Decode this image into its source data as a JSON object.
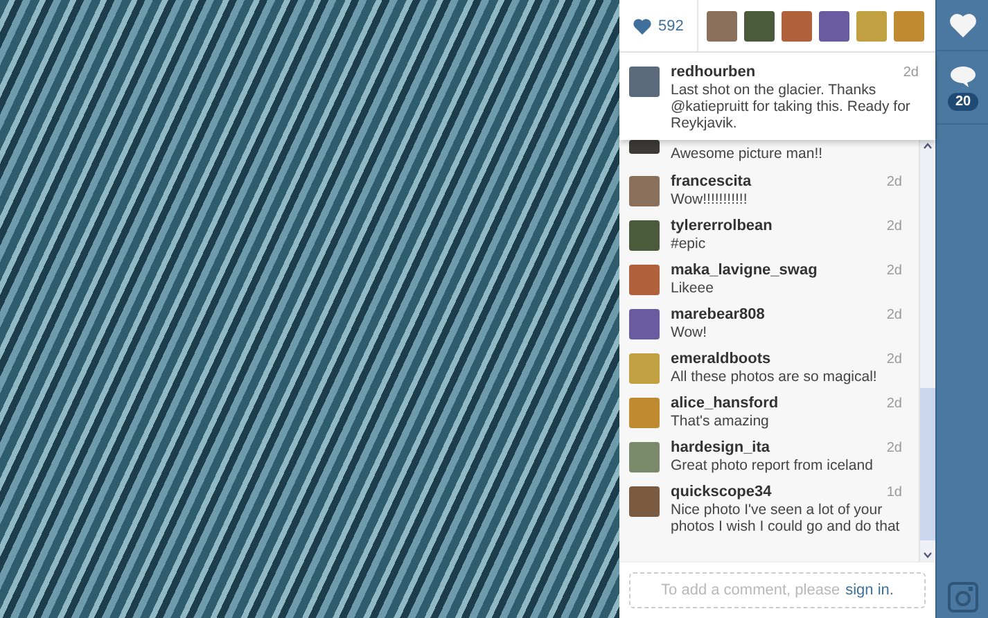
{
  "likes": {
    "count": "592"
  },
  "caption": {
    "username": "redhourben",
    "time": "2d",
    "text": "Last shot on the glacier. Thanks @katiepruitt for taking this. Ready for Reykjavik."
  },
  "comments": [
    {
      "text": "Awesome picture man!!"
    },
    {
      "username": "francescita",
      "time": "2d",
      "text": "Wow!!!!!!!!!!!"
    },
    {
      "username": "tylererrolbean",
      "time": "2d",
      "text": "#epic"
    },
    {
      "username": "maka_lavigne_swag",
      "time": "2d",
      "text": "Likeee"
    },
    {
      "username": "marebear808",
      "time": "2d",
      "text": "Wow!"
    },
    {
      "username": "emeraldboots",
      "time": "2d",
      "text": "All these photos are so magical!"
    },
    {
      "username": "alice_hansford",
      "time": "2d",
      "text": "That's amazing"
    },
    {
      "username": "hardesign_ita",
      "time": "2d",
      "text": "Great photo report from iceland"
    },
    {
      "username": "quickscope34",
      "time": "1d",
      "text": "Nice photo I've seen a lot of your photos I wish I could go and do that"
    }
  ],
  "comment_box": {
    "prompt": "To add a comment, please",
    "link": "sign in."
  },
  "sidebar": {
    "comment_count": "20"
  }
}
